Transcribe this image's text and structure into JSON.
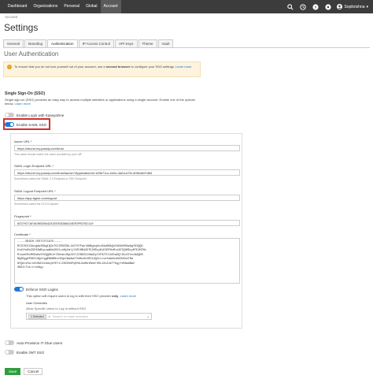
{
  "topbar": {
    "nav": [
      "Dashboard",
      "Organizations",
      "Personal",
      "Global",
      "Account"
    ],
    "active_index": 4,
    "user_name": "Sopikrishna"
  },
  "breadcrumb": "Account",
  "page_title": "Settings",
  "tabs": [
    "General",
    "Branding",
    "Authentication",
    "IP Access Control",
    "API Keys",
    "Theme",
    "Vault"
  ],
  "active_tab": 2,
  "section_title": "User Authentication",
  "alert": {
    "text_before": "To ensure that you do not lock yourself out of your account, use a ",
    "bold": "second browser",
    "text_after": " to configure your SSO settings.",
    "link": "Learn more"
  },
  "sso": {
    "heading": "Single Sign-On (SSO)",
    "description": "Single sign-on (SSO) provides an easy way to access multiple websites or applications using a single account. Enable one of the options below.",
    "learn_more": "Learn more",
    "kaseya_label": "Enable Login with KaseyaOne",
    "saml_label": "Enable SAML SSO"
  },
  "form": {
    "issuer_label": "Issuer URL *",
    "issuer_value": "https://sbond.my.passly.com/trust",
    "issuer_hint": "This value should match the value provided by your IdP",
    "login_label": "SAML Login Endpoint URL *",
    "login_value": "https://sbond.my.passly.com/trust/launch?ApplicationId=183b71cc-ee6c-4a0d-a7fe-d0ffcdd97d84",
    "login_hint": "Sometimes called the SAML 2.0 Endpoint or SSO Endpoint",
    "logout_label": "SAML Logout Endpoint URL *",
    "logout_value": "https://app.itglue.com/logout",
    "logout_hint": "Sometimes called the SLO Endpoint",
    "fingerprint_label": "Fingerprint *",
    "fingerprint_value": "6027927AFAD9B2584231EEE8266624EE9FB70D119",
    "cert_label": "Certificate *",
    "cert_lines": [
      "-----BEGIN CERTIFICATE-----",
      "MIIC0DCCAbigAwIBAgIQZeTUC2RSZS8LJeG707PaelANBgkqhkiG9w0BAQsFADAkMSAwHgYDVQQD",
      "ExdVYmRvZGF0ZWRqcuaW5mIENlcnRpZmljYXRlMB4XDTE2MDcyMjE2MTMzMloXDTQ0MDcyMTE2MTMz",
      "MloweDEzMSEwHwYDVQQDExhTZWxmLXNpZ25lZCBDZXJ0aWZpY2F0ZTCCASIwDQYJKoZIhvcNAQEB",
      "BQADggEPADCCAQoCggEBANMnvH5QzCWwAwO7b6KuXh2RUt9QZcrcveYwWebxK8ZhDm4TMa",
      "NfQkUzSo/oUtMoE4sSdzy6fEYtlZHZX5HPqRhKJobMdtRmb+OHLi0cZdkTTKgyYxRAmABmZ",
      "0RGIrTn1/v+s5Ng="
    ],
    "enforce_label": "Enforce SSO Logins",
    "enforce_desc_before": "This option will require users to log in with their SSO provider ",
    "enforce_desc_bold": "only",
    "enforce_desc_after": ".",
    "enforce_link": "Learn more",
    "overrides_title": "User Overrides",
    "overrides_sub": "Allow Specific Users to Log In without SSO",
    "selected_chip": "1 Selected",
    "select_placeholder": "Search or make selection"
  },
  "bottom_toggles": {
    "auto_provision": "Auto-Provision IT Glue Users",
    "jwt": "Enable JWT SSO"
  },
  "actions": {
    "save": "Save",
    "cancel": "Cancel"
  },
  "colors": {
    "topbar": "#3c3c3c",
    "accent": "#1f7ad6",
    "save": "#2e9e3a",
    "highlight": "#d32f2f",
    "alert_bg": "#fdf3df"
  }
}
